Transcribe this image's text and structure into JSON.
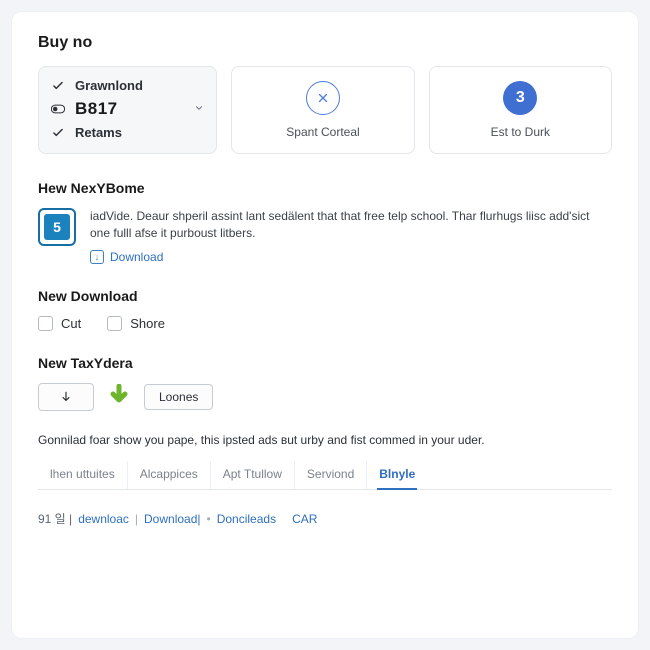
{
  "title": "Buy no",
  "step1": {
    "row1_label": "Grawnlond",
    "code": "B817",
    "row3_label": "Retams"
  },
  "step2": {
    "caption": "Spant Corteal"
  },
  "step3": {
    "num": "3",
    "caption": "Est to Durk"
  },
  "hew": {
    "heading": "Hew NexYBome",
    "thumb_letter": "5",
    "body": "iadVide. Deaur shperil assint lant sedälent that that free telp school. Thar flurhugs liisc add'sict one fulll afse it purboust litbers.",
    "download_label": "Download"
  },
  "newdl": {
    "heading": "New Download",
    "opt1": "Cut",
    "opt2": "Shore"
  },
  "tax": {
    "heading": "New TaxYdera",
    "btn_label": "Loones"
  },
  "desc": "Gonnilad foar show you pape, this ipsted ads вut urby and fist commed in your uder.",
  "tabs": {
    "t1": "lhen uttuites",
    "t2": "Alcappices",
    "t3": "Apt Ttullow",
    "t4": "Serviond",
    "t5": "Blnyle"
  },
  "footer": {
    "pre": "91 일 |",
    "l1": "dewnloac",
    "l2": "Download|",
    "l3": "Doncileads",
    "l4": "CAR"
  }
}
